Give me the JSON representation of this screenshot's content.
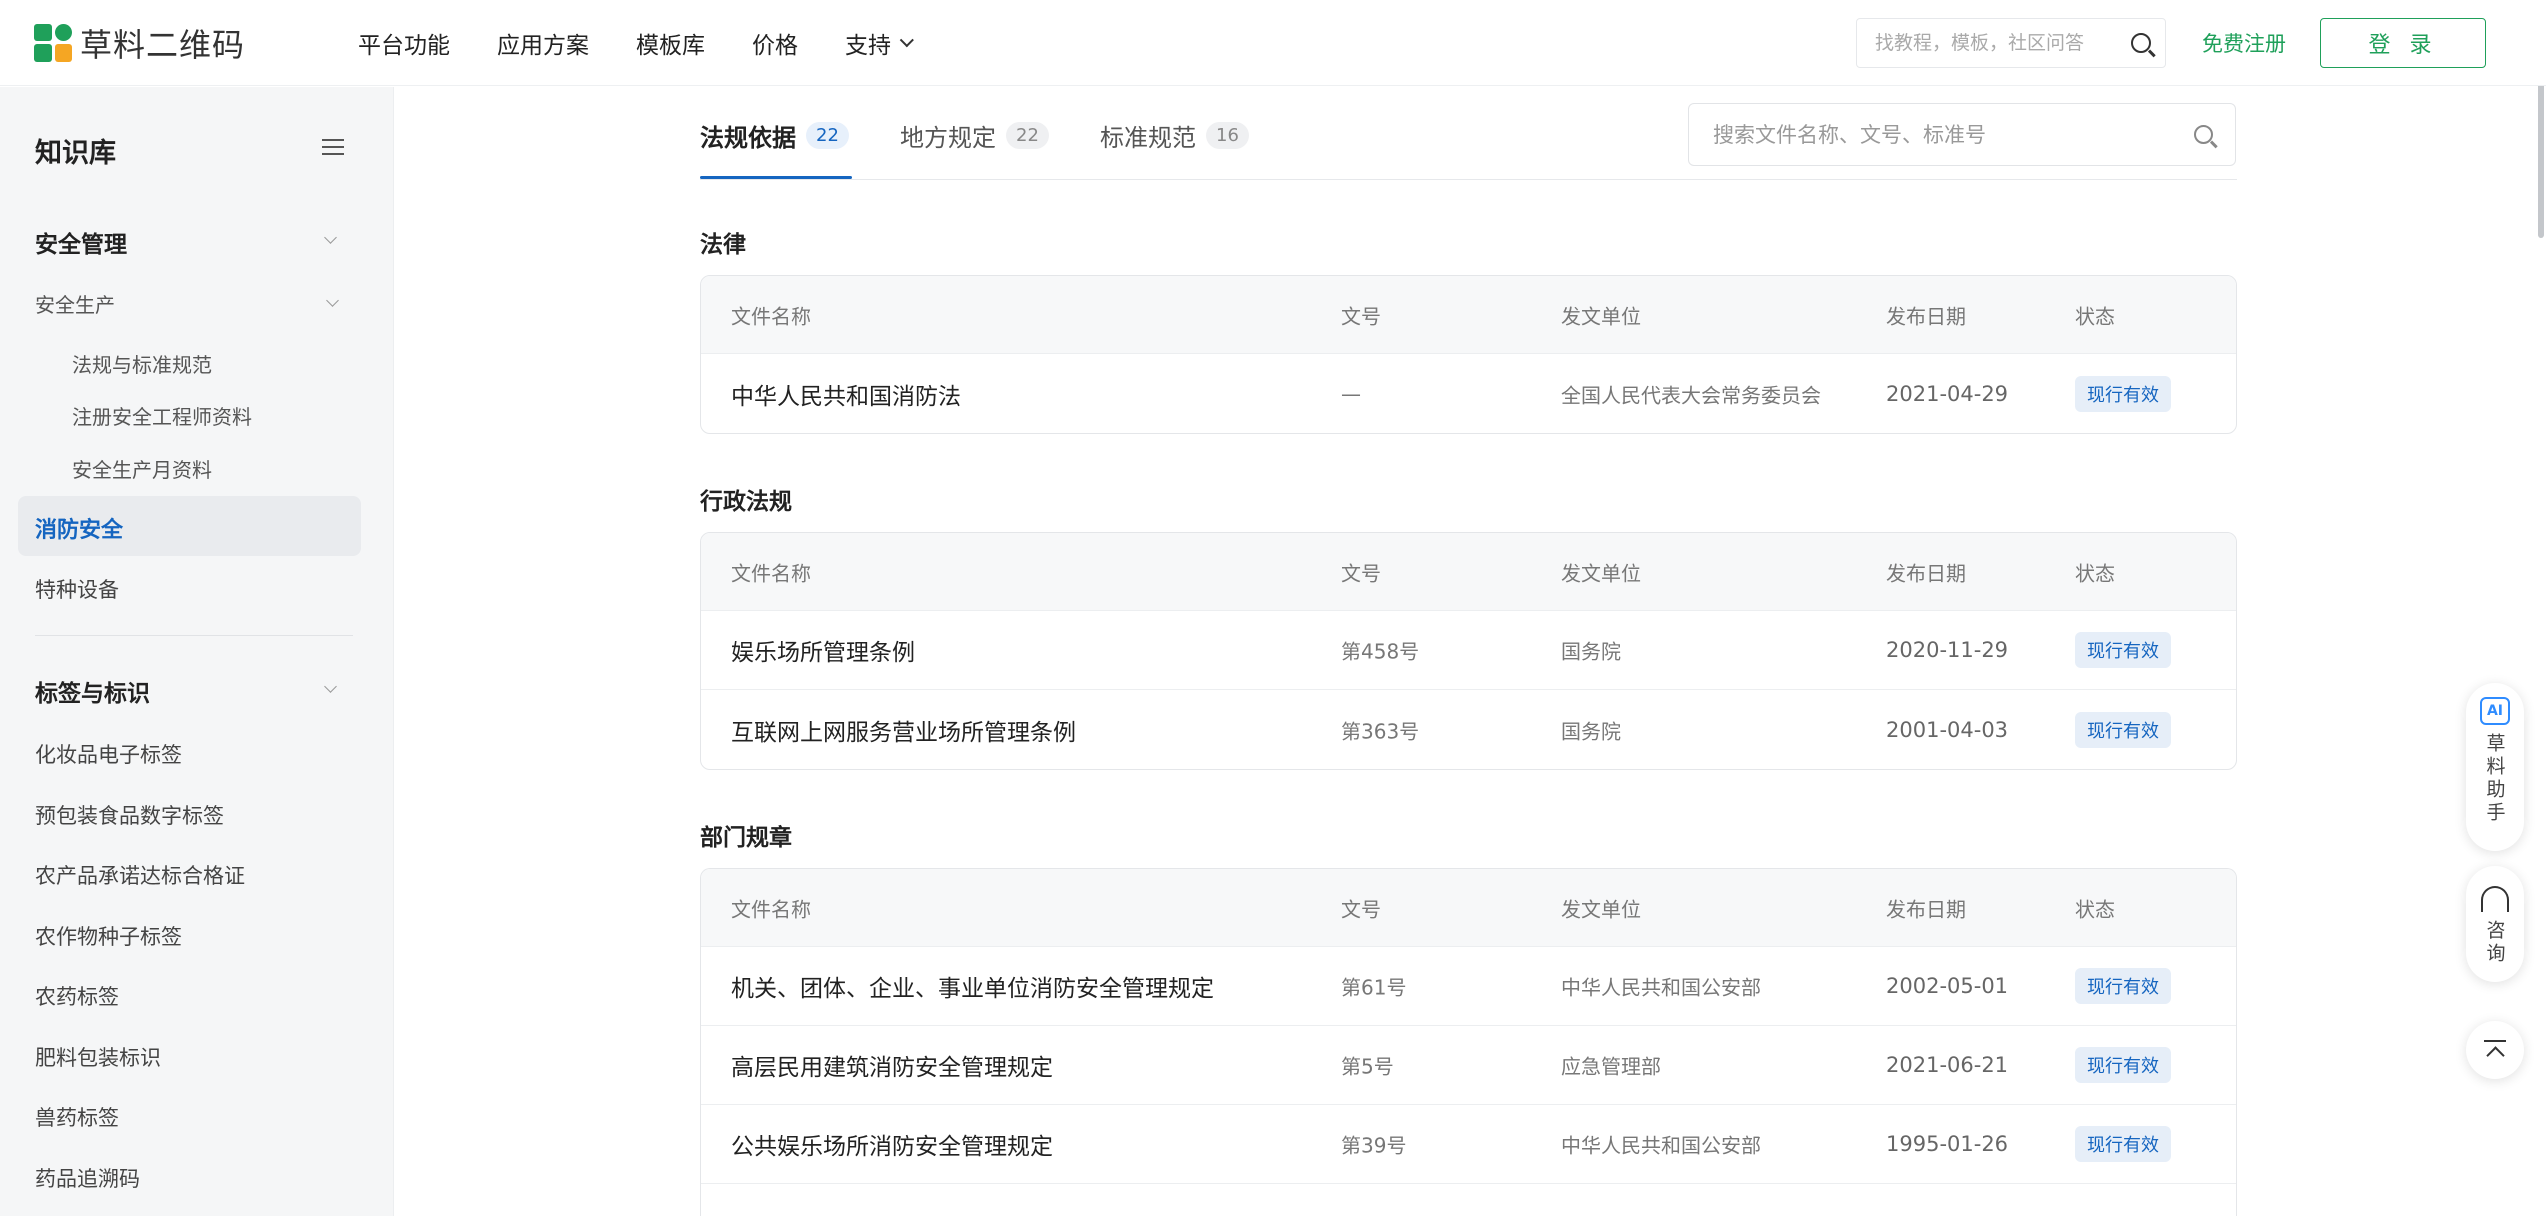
{
  "header": {
    "logo_text": "草料二维码",
    "nav": [
      {
        "label": "平台功能"
      },
      {
        "label": "应用方案"
      },
      {
        "label": "模板库"
      },
      {
        "label": "价格"
      },
      {
        "label": "支持"
      }
    ],
    "search_placeholder": "找教程，模板，社区问答",
    "register_label": "免费注册",
    "login_label": "登 录",
    "brand_color": "#1fa05a"
  },
  "sidebar": {
    "title": "知识库",
    "group1": "安全管理",
    "item_safety_production": "安全生产",
    "sub_items": [
      "法规与标准规范",
      "注册安全工程师资料",
      "安全生产月资料"
    ],
    "active_item": "消防安全",
    "item_special_equipment": "特种设备",
    "group2": "标签与标识",
    "items2": [
      "化妆品电子标签",
      "预包装食品数字标签",
      "农产品承诺达标合格证",
      "农作物种子标签",
      "农药标签",
      "肥料包装标识",
      "兽药标签",
      "药品追溯码"
    ]
  },
  "tabs": [
    {
      "label": "法规依据",
      "count": "22"
    },
    {
      "label": "地方规定",
      "count": "22"
    },
    {
      "label": "标准规范",
      "count": "16"
    }
  ],
  "main_search_placeholder": "搜索文件名称、文号、标准号",
  "table_headers": {
    "name": "文件名称",
    "no": "文号",
    "org": "发文单位",
    "date": "发布日期",
    "status": "状态"
  },
  "sections": [
    {
      "title": "法律",
      "rows": [
        {
          "name": "中华人民共和国消防法",
          "no": "—",
          "org": "全国人民代表大会常务委员会",
          "date": "2021-04-29",
          "status": "现行有效"
        }
      ]
    },
    {
      "title": "行政法规",
      "rows": [
        {
          "name": "娱乐场所管理条例",
          "no": "第458号",
          "org": "国务院",
          "date": "2020-11-29",
          "status": "现行有效"
        },
        {
          "name": "互联网上网服务营业场所管理条例",
          "no": "第363号",
          "org": "国务院",
          "date": "2001-04-03",
          "status": "现行有效"
        }
      ]
    },
    {
      "title": "部门规章",
      "rows": [
        {
          "name": "机关、团体、企业、事业单位消防安全管理规定",
          "no": "第61号",
          "org": "中华人民共和国公安部",
          "date": "2002-05-01",
          "status": "现行有效"
        },
        {
          "name": "高层民用建筑消防安全管理规定",
          "no": "第5号",
          "org": "应急管理部",
          "date": "2021-06-21",
          "status": "现行有效"
        },
        {
          "name": "公共娱乐场所消防安全管理规定",
          "no": "第39号",
          "org": "中华人民共和国公安部",
          "date": "1995-01-26",
          "status": "现行有效"
        }
      ]
    }
  ],
  "float": {
    "assistant_label": "草料助手",
    "consult_label": "咨询",
    "ai_icon_text": "AI"
  }
}
